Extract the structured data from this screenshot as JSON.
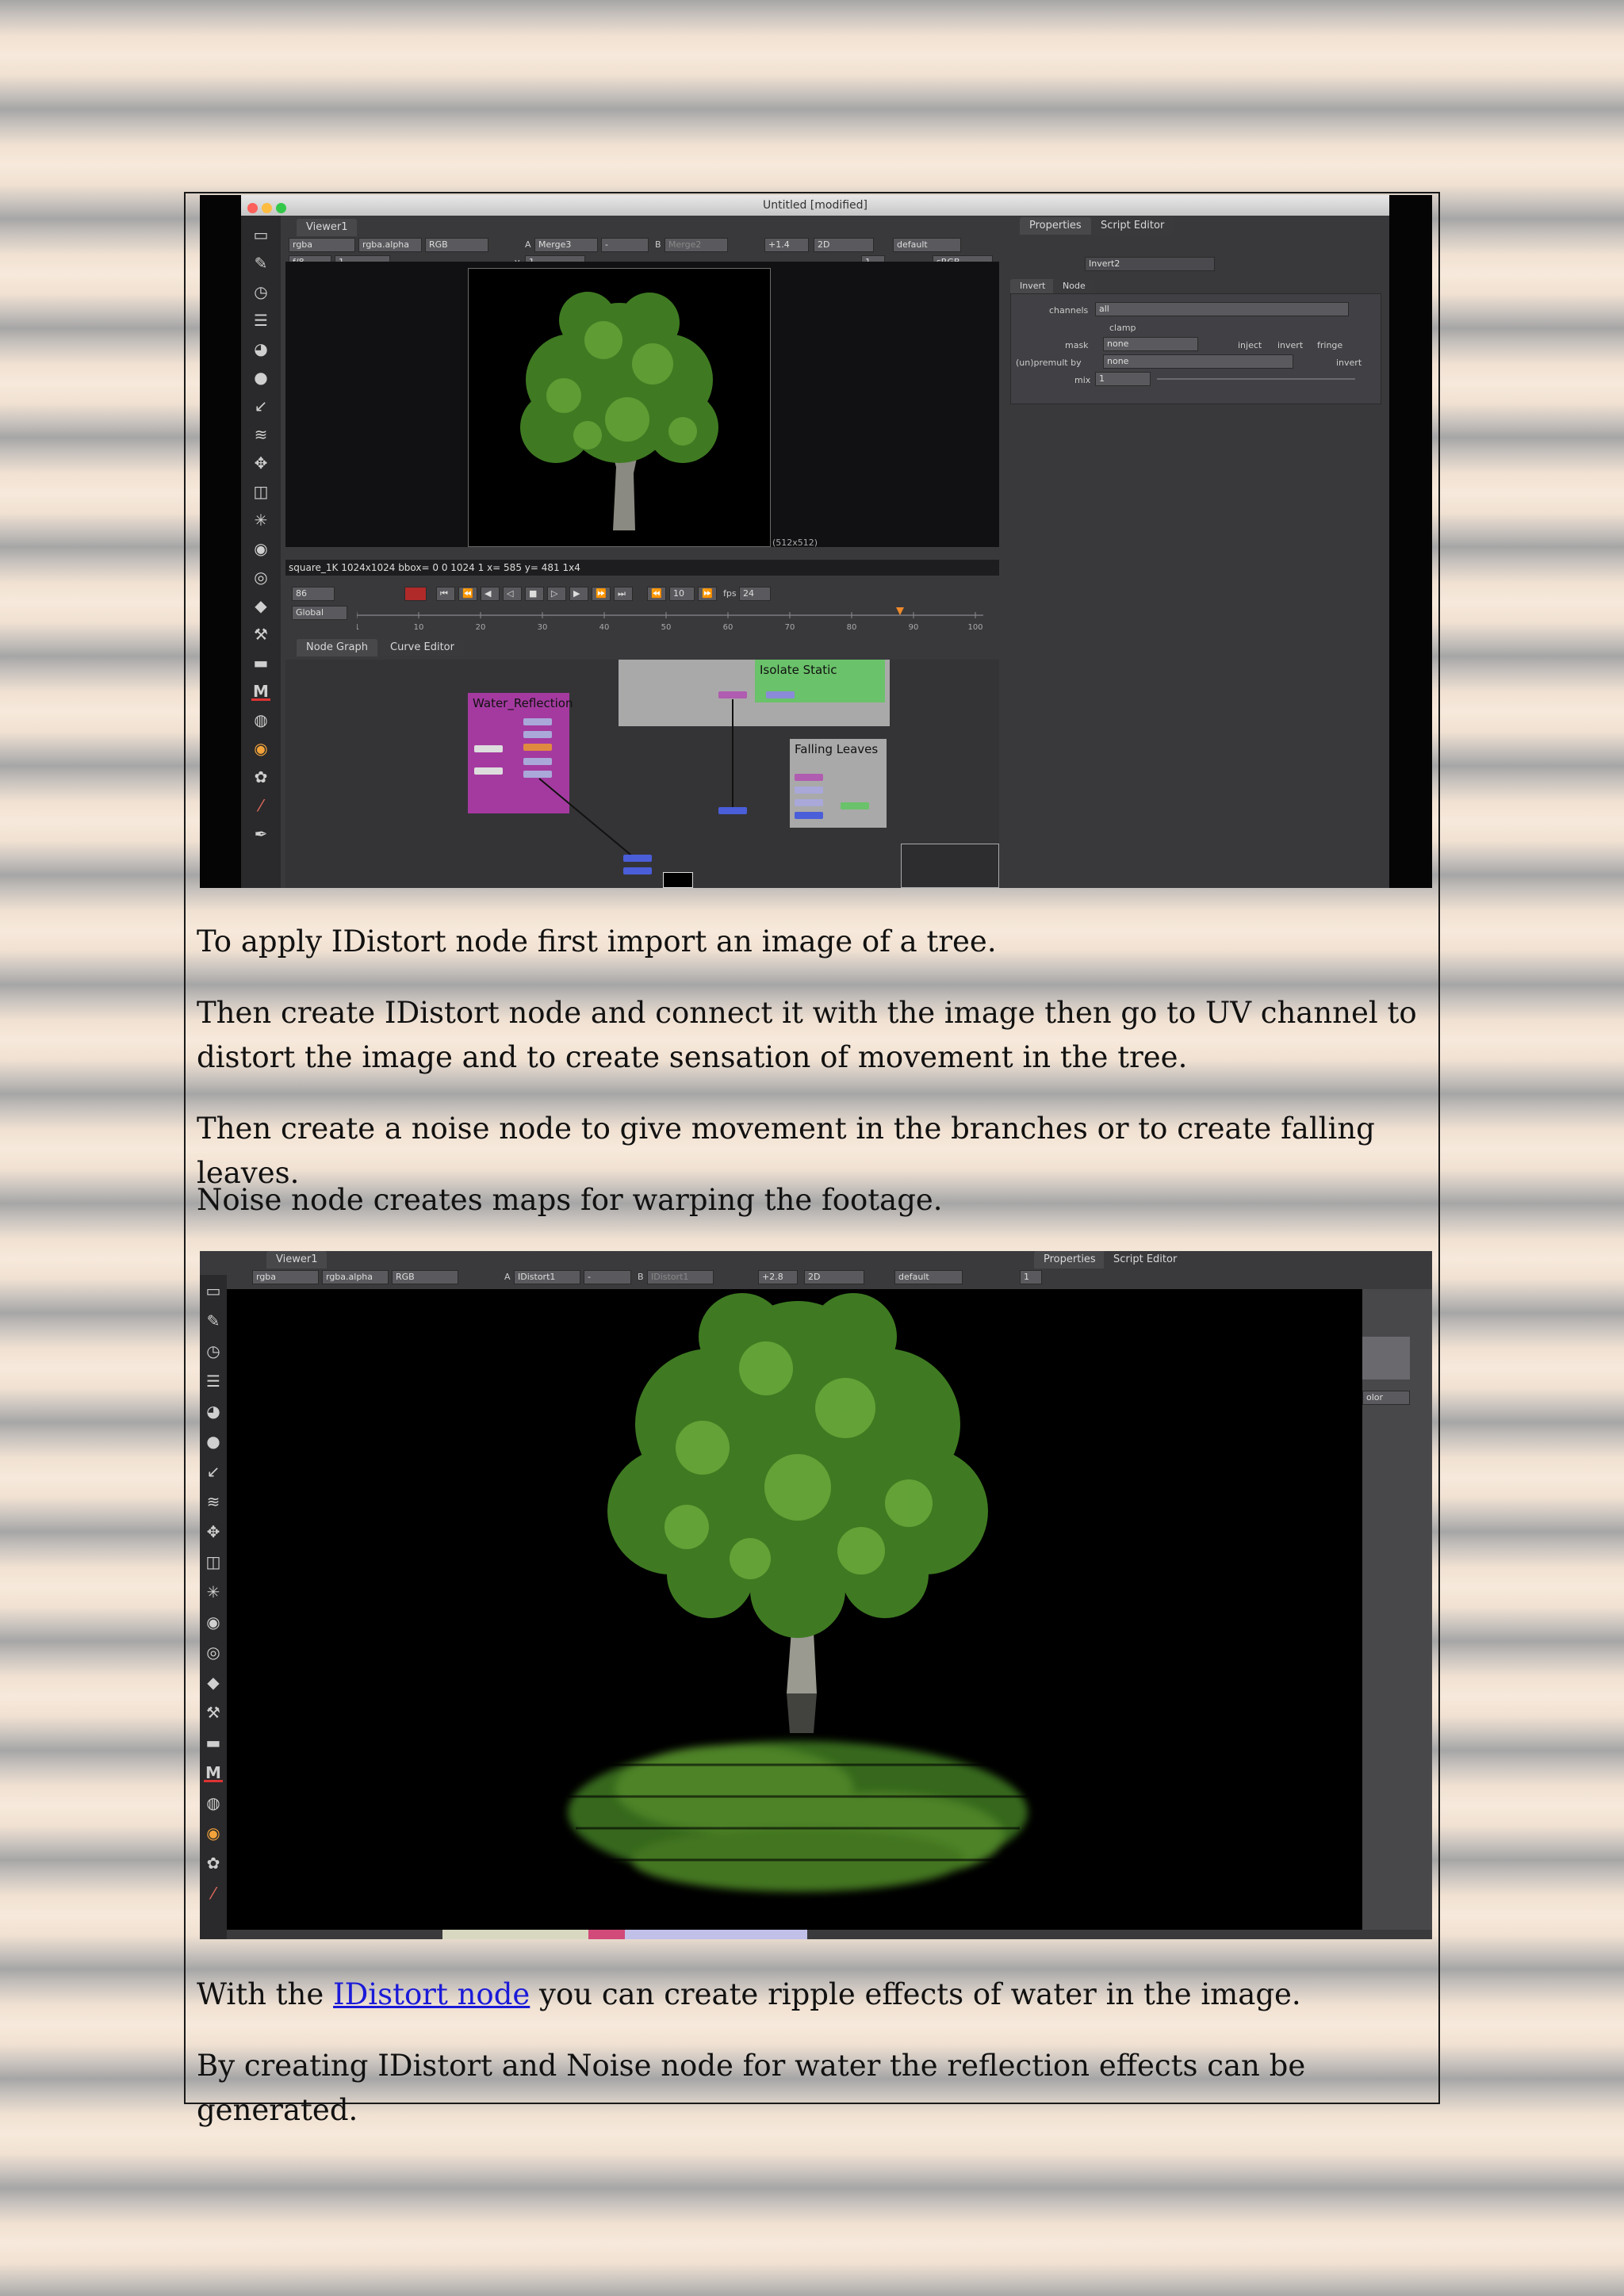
{
  "paragraphs": {
    "p1": "To apply IDistort node first import an image of a tree.",
    "p2": "Then create IDistort node and connect it with the image then go to UV channel to distort the image and to create sensation of movement in the tree.",
    "p3": "Then create a noise node to give movement in the branches or to create falling leaves.",
    "p4": "Noise node creates maps for warping the footage.",
    "p5_before": "With the ",
    "p5_link": "IDistort node",
    "p5_after": " you can create ripple effects of water in the image.",
    "p6": "By creating IDistort and Noise node for water the reflection effects can be generated."
  },
  "screenshot1": {
    "window_title": "Untitled [modified]",
    "viewer_tab": "Viewer1",
    "properties_tab": "Properties",
    "script_editor_tab": "Script Editor",
    "channels": "rgba",
    "alpha": "rgba.alpha",
    "colorspace": "RGB",
    "input_a_label": "A",
    "input_a": "Merge3",
    "input_b_label": "B",
    "input_b": "Merge2",
    "gain": "+1.4",
    "view_mode": "2D",
    "lut": "default",
    "fstop": "f/8",
    "frame_field": "1",
    "gamma_label": "y",
    "gamma": "1",
    "display_lut": "sRGB",
    "image_size": "(512x512)",
    "info_bar": "square_1K 1024x1024 bbox= 0 0 1024 1  x= 585 y= 481   1x4",
    "current_frame": "86",
    "step": "10",
    "fps_label": "fps",
    "fps": "24",
    "global": "Global",
    "timeline_ticks": [
      "1",
      "10",
      "20",
      "30",
      "40",
      "50",
      "60",
      "70",
      "80",
      "90",
      "100"
    ],
    "node_graph_tab": "Node Graph",
    "curve_editor_tab": "Curve Editor",
    "backdrop_water": "Water_Reflection",
    "backdrop_isolate": "Isolate Static",
    "backdrop_leaves": "Falling Leaves",
    "node_name": "Invert2",
    "node_tab_invert": "Invert",
    "node_tab_node": "Node",
    "channels_label": "channels",
    "channels_value": "all",
    "clamp_label": "clamp",
    "mask_label": "mask",
    "mask_value": "none",
    "inject_label": "inject",
    "invert_label": "invert",
    "fringe_label": "fringe",
    "premult_label": "(un)premult by",
    "premult_value": "none",
    "invert2_label": "invert",
    "mix_label": "mix",
    "mix_value": "1"
  },
  "screenshot2": {
    "viewer_tab": "Viewer1",
    "properties_tab": "Properties",
    "script_editor_tab": "Script Editor",
    "channels": "rgba",
    "alpha": "rgba.alpha",
    "colorspace": "RGB",
    "input_a_label": "A",
    "input_a": "IDistort1",
    "input_b_label": "B",
    "input_b": "IDistort1",
    "gain": "+2.8",
    "view_mode": "2D",
    "lut": "default",
    "panel_field": "1",
    "color_label": "olor"
  },
  "colors": {
    "link": "#1a1ad8",
    "water_backdrop": "#a43aa0",
    "isolate_backdrop": "#6ac26a",
    "leaves_backdrop": "#a9a9a9",
    "tree_green": "#3f7a22"
  },
  "toolbar_icons": [
    "transform-icon",
    "paint-icon",
    "time-icon",
    "channel-icon",
    "color-icon",
    "filter-icon",
    "keyer-icon",
    "merge-icon",
    "move-icon",
    "3d-icon",
    "particles-icon",
    "deep-icon",
    "views-icon",
    "metadata-icon",
    "toolsets-icon",
    "other-icon",
    "m-icon"
  ]
}
